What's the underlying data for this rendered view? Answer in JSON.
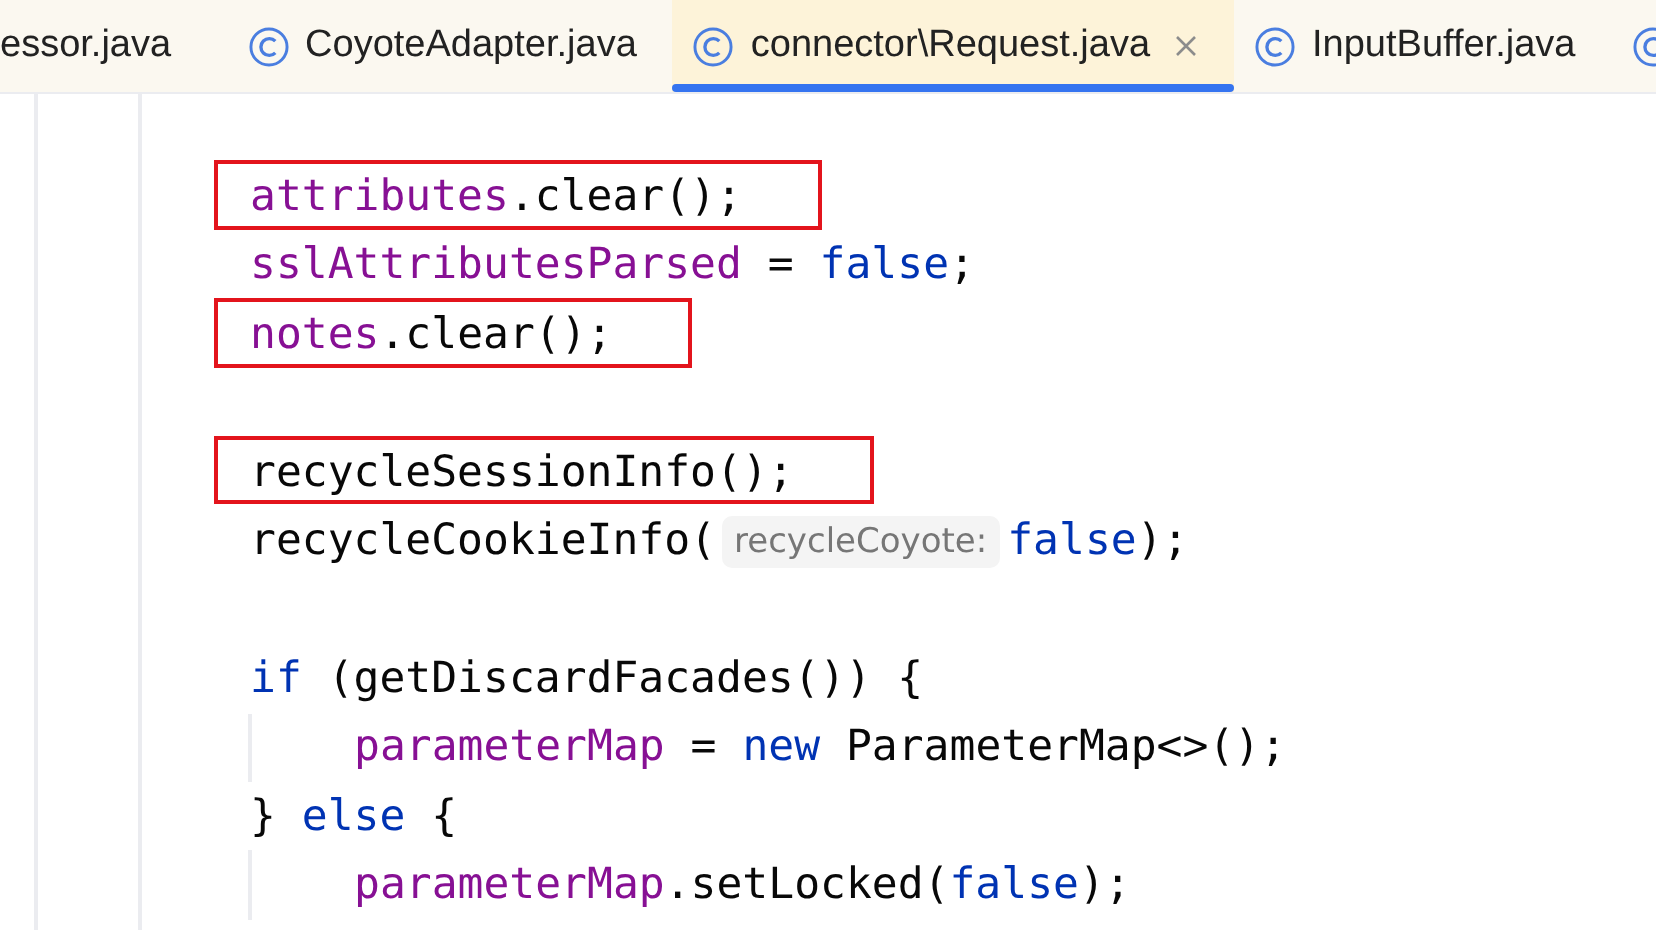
{
  "tabs": [
    {
      "label": "essor.java",
      "icon": false,
      "selected": false
    },
    {
      "label": "CoyoteAdapter.java",
      "icon": true,
      "selected": false
    },
    {
      "label": "connector\\Request.java",
      "icon": true,
      "selected": true
    },
    {
      "label": "InputBuffer.java",
      "icon": true,
      "selected": false
    },
    {
      "icon": true,
      "selected": false
    }
  ],
  "code_lines": [
    {
      "kind": "blank"
    },
    {
      "highlighted": true,
      "tokens": [
        {
          "kind": "field",
          "text": "attributes"
        },
        {
          "kind": "plain",
          "text": ".clear();"
        }
      ]
    },
    {
      "highlighted": false,
      "tokens": [
        {
          "kind": "field",
          "text": "sslAttributesParsed"
        },
        {
          "kind": "plain",
          "text": " = "
        },
        {
          "kind": "keyword",
          "text": "false"
        },
        {
          "kind": "plain",
          "text": ";"
        }
      ]
    },
    {
      "highlighted": true,
      "tokens": [
        {
          "kind": "field",
          "text": "notes"
        },
        {
          "kind": "plain",
          "text": ".clear();"
        }
      ]
    },
    {
      "kind": "blank"
    },
    {
      "highlighted": true,
      "tokens": [
        {
          "kind": "plain",
          "text": "recycleSessionInfo();"
        }
      ]
    },
    {
      "highlighted": false,
      "tokens": [
        {
          "kind": "plain",
          "text": "recycleCookieInfo("
        },
        {
          "kind": "hint",
          "text": "recycleCoyote:"
        },
        {
          "kind": "keyword",
          "text": "false"
        },
        {
          "kind": "plain",
          "text": ");"
        }
      ]
    },
    {
      "kind": "blank"
    },
    {
      "highlighted": false,
      "tokens": [
        {
          "kind": "keyword",
          "text": "if"
        },
        {
          "kind": "plain",
          "text": " (getDiscardFacades()) {"
        }
      ],
      "children": [
        {
          "highlighted": false,
          "tokens": [
            {
              "kind": "field",
              "text": "parameterMap"
            },
            {
              "kind": "plain",
              "text": " = "
            },
            {
              "kind": "keyword",
              "text": "new"
            },
            {
              "kind": "plain",
              "text": " ParameterMap<>();"
            }
          ]
        }
      ]
    },
    {
      "highlighted": false,
      "tokens": [
        {
          "kind": "plain",
          "text": "} "
        },
        {
          "kind": "keyword",
          "text": "else"
        },
        {
          "kind": "plain",
          "text": " {"
        }
      ],
      "children": [
        {
          "highlighted": false,
          "tokens": [
            {
              "kind": "field",
              "text": "parameterMap"
            },
            {
              "kind": "plain",
              "text": ".setLocked("
            },
            {
              "kind": "keyword",
              "text": "false"
            },
            {
              "kind": "plain",
              "text": ");"
            }
          ]
        }
      ]
    }
  ]
}
